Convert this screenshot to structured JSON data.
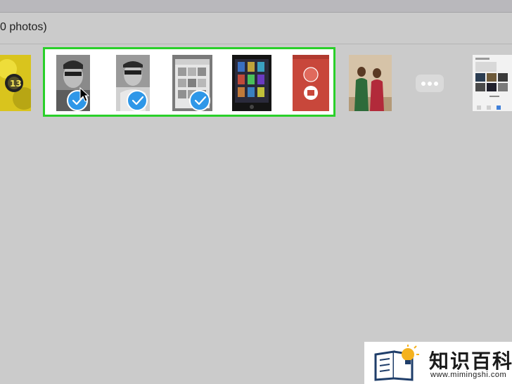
{
  "window": {
    "header_title": "0 photos)"
  },
  "more_button": {
    "icon": "ellipsis-icon"
  },
  "colors": {
    "selection_border": "#2ad02a",
    "checkmark": "#2e97e8"
  },
  "logo": {
    "chinese_text": "知识百科",
    "url": "www.mimingshi.com"
  },
  "thumbnails": [
    {
      "name": "yellow-flower",
      "selected": false
    },
    {
      "name": "portrait-bw-1",
      "selected": true
    },
    {
      "name": "portrait-bw-2",
      "selected": true
    },
    {
      "name": "app-grid-screenshot",
      "selected": true
    },
    {
      "name": "ibooks-screenshot",
      "selected": false
    },
    {
      "name": "mymoment-app-screenshot",
      "selected": false
    },
    {
      "name": "family-photo",
      "selected": false
    },
    {
      "name": "web-screenshot",
      "selected": false
    }
  ]
}
